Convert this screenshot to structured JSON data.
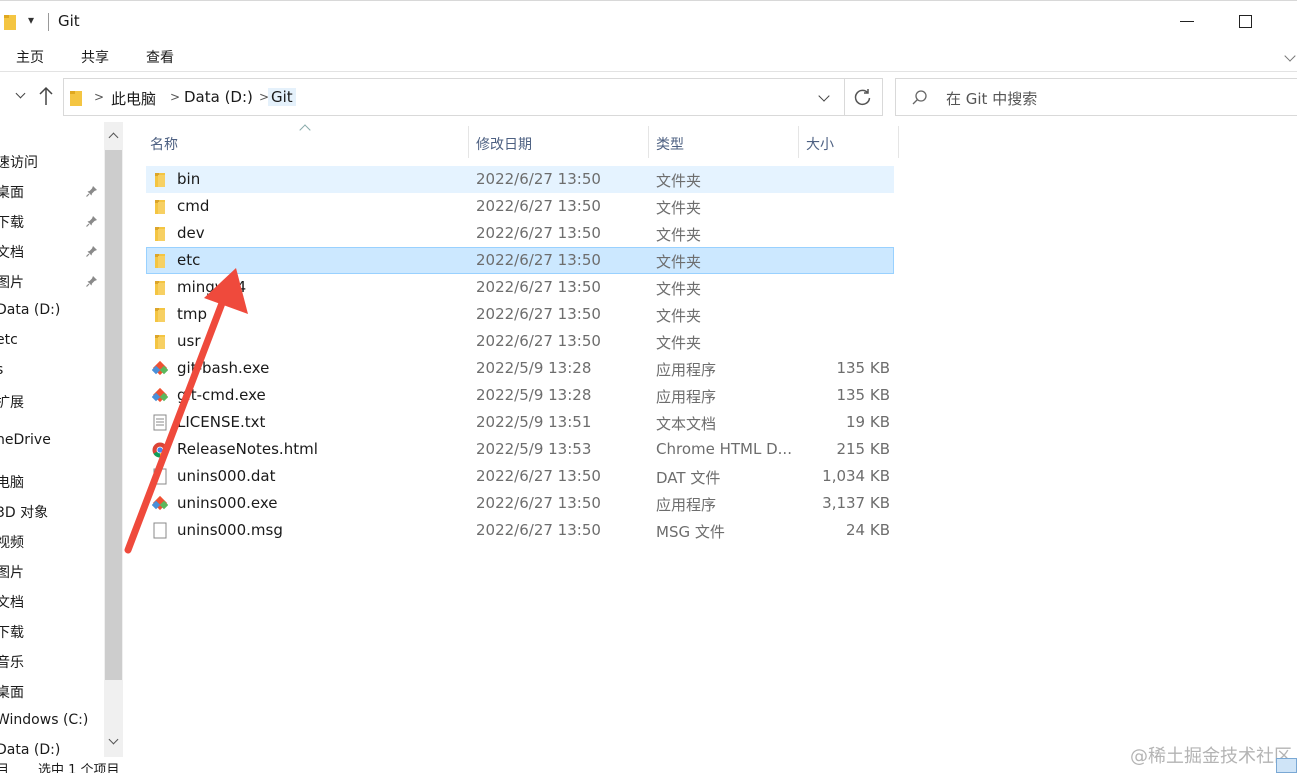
{
  "window": {
    "title": "Git",
    "quick_access_glyph": "▾"
  },
  "ribbon": {
    "tabs": [
      "主页",
      "共享",
      "查看"
    ]
  },
  "address": {
    "crumbs": [
      "此电脑",
      "Data (D:)",
      "Git"
    ],
    "separator": ">"
  },
  "search": {
    "placeholder": "在 Git 中搜索"
  },
  "sidebar": {
    "items": [
      {
        "label": "速访问",
        "pinned": false
      },
      {
        "label": "桌面",
        "pinned": true
      },
      {
        "label": "下载",
        "pinned": true
      },
      {
        "label": "文档",
        "pinned": true
      },
      {
        "label": "图片",
        "pinned": true
      },
      {
        "label": "Data (D:)",
        "pinned": false
      },
      {
        "label": "etc",
        "pinned": false
      },
      {
        "label": "s",
        "pinned": false
      },
      {
        "label": "扩展",
        "pinned": false
      },
      {
        "label": "neDrive",
        "pinned": false
      },
      {
        "label": "电脑",
        "pinned": false
      },
      {
        "label": "3D 对象",
        "pinned": false
      },
      {
        "label": "视频",
        "pinned": false
      },
      {
        "label": "图片",
        "pinned": false
      },
      {
        "label": "文档",
        "pinned": false
      },
      {
        "label": "下载",
        "pinned": false
      },
      {
        "label": "音乐",
        "pinned": false
      },
      {
        "label": "桌面",
        "pinned": false
      },
      {
        "label": "Windows (C:)",
        "pinned": false
      },
      {
        "label": "Data (D:)",
        "pinned": false
      }
    ]
  },
  "columns": {
    "name": "名称",
    "date": "修改日期",
    "type": "类型",
    "size": "大小"
  },
  "files": [
    {
      "name": "bin",
      "date": "2022/6/27 13:50",
      "type": "文件夹",
      "size": "",
      "icon": "folder-icon",
      "state": "hover"
    },
    {
      "name": "cmd",
      "date": "2022/6/27 13:50",
      "type": "文件夹",
      "size": "",
      "icon": "folder-icon",
      "state": ""
    },
    {
      "name": "dev",
      "date": "2022/6/27 13:50",
      "type": "文件夹",
      "size": "",
      "icon": "folder-icon",
      "state": ""
    },
    {
      "name": "etc",
      "date": "2022/6/27 13:50",
      "type": "文件夹",
      "size": "",
      "icon": "folder-icon",
      "state": "selected"
    },
    {
      "name": "mingw64",
      "date": "2022/6/27 13:50",
      "type": "文件夹",
      "size": "",
      "icon": "folder-icon",
      "state": ""
    },
    {
      "name": "tmp",
      "date": "2022/6/27 13:50",
      "type": "文件夹",
      "size": "",
      "icon": "folder-icon",
      "state": ""
    },
    {
      "name": "usr",
      "date": "2022/6/27 13:50",
      "type": "文件夹",
      "size": "",
      "icon": "folder-icon",
      "state": ""
    },
    {
      "name": "git-bash.exe",
      "date": "2022/5/9 13:28",
      "type": "应用程序",
      "size": "135 KB",
      "icon": "git-app-icon",
      "state": ""
    },
    {
      "name": "git-cmd.exe",
      "date": "2022/5/9 13:28",
      "type": "应用程序",
      "size": "135 KB",
      "icon": "git-app-icon",
      "state": ""
    },
    {
      "name": "LICENSE.txt",
      "date": "2022/5/9 13:51",
      "type": "文本文档",
      "size": "19 KB",
      "icon": "text-file-icon",
      "state": ""
    },
    {
      "name": "ReleaseNotes.html",
      "date": "2022/5/9 13:53",
      "type": "Chrome HTML D...",
      "size": "215 KB",
      "icon": "chrome-icon",
      "state": ""
    },
    {
      "name": "unins000.dat",
      "date": "2022/6/27 13:50",
      "type": "DAT 文件",
      "size": "1,034 KB",
      "icon": "blank-file-icon",
      "state": ""
    },
    {
      "name": "unins000.exe",
      "date": "2022/6/27 13:50",
      "type": "应用程序",
      "size": "3,137 KB",
      "icon": "git-app-icon",
      "state": ""
    },
    {
      "name": "unins000.msg",
      "date": "2022/6/27 13:50",
      "type": "MSG 文件",
      "size": "24 KB",
      "icon": "blank-file-icon",
      "state": ""
    }
  ],
  "status": {
    "items_count": "目",
    "selection": "选中 1 个项目"
  },
  "watermark": "@稀土掘金技术社区",
  "colors": {
    "selection_bg": "#cce8ff",
    "selection_border": "#99d1ff",
    "hover_bg": "#e5f3ff",
    "folder_yellow": "#f4c542",
    "arrow_red": "#ef4a3c",
    "header_text": "#4d6082"
  }
}
